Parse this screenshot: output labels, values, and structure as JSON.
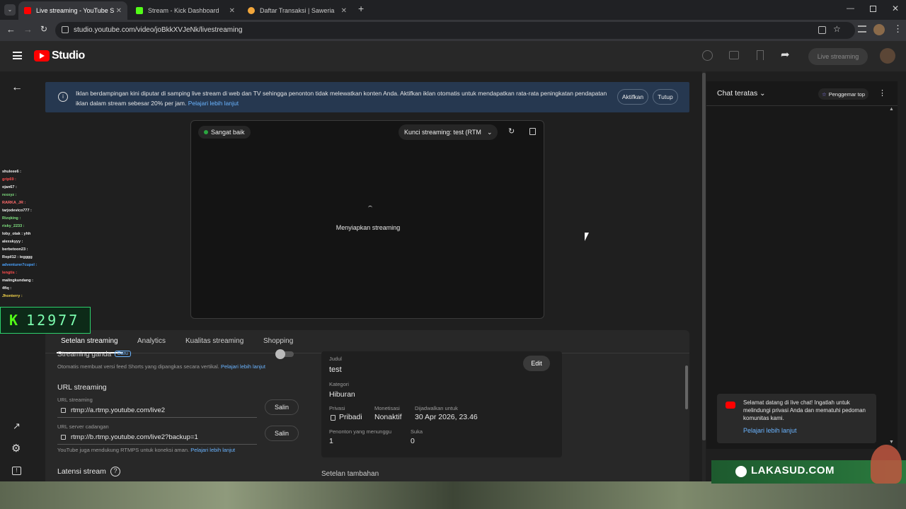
{
  "browser": {
    "tabs": [
      {
        "title": "Live streaming - YouTube Studio",
        "active": true,
        "favicon_color": "#ff0000"
      },
      {
        "title": "Stream - Kick Dashboard",
        "active": false,
        "favicon_color": "#53fc18"
      },
      {
        "title": "Daftar Transaksi | Saweria",
        "active": false,
        "favicon_color": "#f2a63b"
      }
    ],
    "url": "studio.youtube.com/video/joBkkXVJeNk/livestreaming"
  },
  "header": {
    "brand": "Studio",
    "live_button": "Live streaming"
  },
  "banner": {
    "text": "Iklan berdampingan kini diputar di samping live stream di web dan TV sehingga penonton tidak melewatkan konten Anda. Aktifkan iklan otomatis untuk mendapatkan rata-rata peningkatan pendapatan iklan dalam stream sebesar 20% per jam.",
    "link": "Pelajari lebih lanjut",
    "enable_button": "Aktifkan",
    "close_button": "Tutup"
  },
  "player": {
    "status": "Sangat baik",
    "stream_key": "Kunci streaming: test (RTM",
    "message": "Menyiapkan streaming"
  },
  "panel": {
    "tabs": [
      "Setelan streaming",
      "Analytics",
      "Kualitas streaming",
      "Shopping"
    ],
    "dual_stream_title": "Streaming ganda",
    "dual_stream_badge": "Baru",
    "dual_stream_desc": "Otomatis membuat versi feed Shorts yang dipangkas secara vertikal.",
    "learn_more": "Pelajari lebih lanjut",
    "url_section": "URL streaming",
    "url_label": "URL streaming",
    "url_value": "rtmp://a.rtmp.youtube.com/live2",
    "backup_label": "URL server cadangan",
    "backup_value": "rtmp://b.rtmp.youtube.com/live2?backup=1",
    "copy_button": "Salin",
    "rtmps_note": "YouTube juga mendukung RTMPS untuk koneksi aman.",
    "latency_title": "Latensi stream"
  },
  "details": {
    "title_label": "Judul",
    "title_value": "test",
    "edit_button": "Edit",
    "category_label": "Kategori",
    "category_value": "Hiburan",
    "privacy_label": "Privasi",
    "privacy_value": "Pribadi",
    "monetization_label": "Monetisasi",
    "monetization_value": "Nonaktif",
    "scheduled_label": "Dijadwalkan untuk",
    "scheduled_value": "30 Apr 2026, 23.46",
    "waiting_label": "Penonton yang menunggu",
    "waiting_value": "1",
    "likes_label": "Suka",
    "likes_value": "0",
    "extra_settings": "Setelan tambahan"
  },
  "chat": {
    "header": "Chat teratas",
    "fans_button": "Penggemar top",
    "welcome": "Selamat datang di live chat! Ingatlah untuk melindungi privasi Anda dan mematuhi pedoman komunitas kami.",
    "learn_more": "Pelajari lebih lanjut"
  },
  "overlay": {
    "chat_lines": [
      {
        "text": "shuleee6 :",
        "color": "#f0f0f0"
      },
      {
        "text": "grip69 :",
        "color": "#ff4d4d"
      },
      {
        "text": "ojan67 :",
        "color": "#f0f0f0"
      },
      {
        "text": "rexxyz :",
        "color": "#7fe07f"
      },
      {
        "text": "RARKA_JR :",
        "color": "#ff6b6b"
      },
      {
        "text": "tarjodevico777 :",
        "color": "#f0f0f0"
      },
      {
        "text": "Rizqking :",
        "color": "#7fe07f"
      },
      {
        "text": "risky_2233 :",
        "color": "#7fe07f"
      },
      {
        "text": "loby_otak : yhh",
        "color": "#f0f0f0"
      },
      {
        "text": "alexskyyy :",
        "color": "#f0f0f0"
      },
      {
        "text": "berbetoon23 :",
        "color": "#f0f0f0"
      },
      {
        "text": "Ropil12 : iegggg",
        "color": "#f0f0f0"
      },
      {
        "text": "adventurer7cupel :",
        "color": "#4aa3ff"
      },
      {
        "text": "lengtis :",
        "color": "#ff4d4d"
      },
      {
        "text": "malingkundang :",
        "color": "#f0f0f0"
      },
      {
        "text": "4fiq :",
        "color": "#f0f0f0"
      },
      {
        "text": "Jhonterry :",
        "color": "#f5d64a"
      }
    ],
    "counter": "12977",
    "watermark": "LAKASUD.COM"
  }
}
